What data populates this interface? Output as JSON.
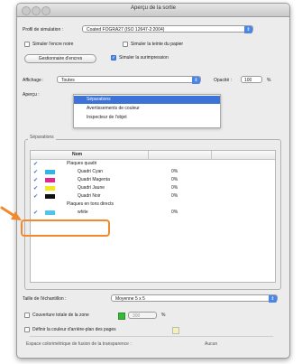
{
  "window": {
    "title": "Aperçu de la sortie"
  },
  "profile": {
    "label": "Profil de simulation :",
    "value": "Coated FOGRA27 (ISO 12647-2:2004)"
  },
  "options": {
    "black_ink": "Simuler l'encre noire",
    "paper_color": "Simuler la teinte du papier",
    "overprint_button": "Gestionnaire d'encres",
    "overprint": "Simuler la surimpression"
  },
  "display": {
    "label": "Affichage :",
    "value": "Toutes",
    "opacity_label": "Opacité :",
    "opacity_value": "100",
    "opacity_unit": "%"
  },
  "preview": {
    "label": "Aperçu :",
    "menu": [
      "Séparations",
      "Avertissements de couleur",
      "Inspecteur de l'objet"
    ]
  },
  "separations": {
    "group_label": "Séparations",
    "column_name": "Nom",
    "rows": [
      {
        "name": "Plaques quadri",
        "pct": "",
        "color": ""
      },
      {
        "name": "Quadri Cyan",
        "pct": "0%",
        "color": "#2fb5e8"
      },
      {
        "name": "Quadri Magenta",
        "pct": "0%",
        "color": "#e2288f"
      },
      {
        "name": "Quadri Jaune",
        "pct": "0%",
        "color": "#f4e81c"
      },
      {
        "name": "Quadri Noir",
        "pct": "0%",
        "color": "#111111"
      },
      {
        "name": "Plaques en tons directs",
        "pct": "",
        "color": ""
      },
      {
        "name": "white",
        "pct": "0%",
        "color": "#4cc5ef"
      }
    ]
  },
  "sample": {
    "label": "Taille de l'échantillon :",
    "value": "Moyenne 5 x 5"
  },
  "coverage": {
    "label": "Couverture totale de la zone",
    "value": "300",
    "unit": "%"
  },
  "bg_color": {
    "label": "Définir la couleur d'arrière-plan des pages"
  },
  "blend": {
    "label": "Espace colorimétrique de fusion de la transparence :",
    "value": "Aucun"
  },
  "colors": {
    "accent": "#4a86e8",
    "highlight": "#f08a2c"
  }
}
